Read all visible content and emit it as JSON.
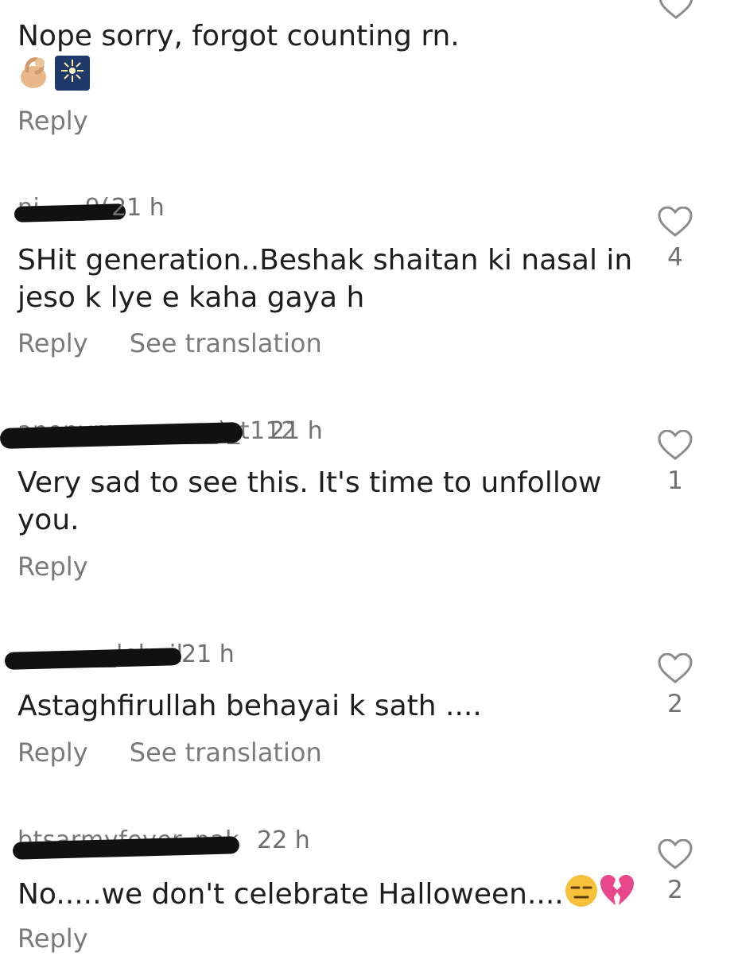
{
  "comments": [
    {
      "username": "",
      "time": "",
      "text": "Nope sorry, forgot counting rn.",
      "emojis": [
        "pinched-fingers-emoji",
        "fireworks-emoji"
      ],
      "reply_label": "Reply",
      "translation_label": "",
      "likes": ""
    },
    {
      "username": "ni__ _9(",
      "time": "21 h",
      "text": "SHit generation..Beshak shaitan ki nasal in jeso k lye e kaha gaya h",
      "reply_label": "Reply",
      "translation_label": "See translation",
      "likes": "4"
    },
    {
      "username": "anonymo_______)_t112",
      "time": "21 h",
      "text": "Very sad to see this. It's time to unfollow you.",
      "reply_label": "Reply",
      "translation_label": "",
      "likes": "1"
    },
    {
      "username": "________lehuil",
      "time": "21 h",
      "text": "Astaghfirullah behayai k sath ....",
      "reply_label": "Reply",
      "translation_label": "See translation",
      "likes": "2"
    },
    {
      "username": "btsarmyfever_pak",
      "time": "22 h",
      "text": "No.....we don't celebrate Halloween....",
      "emojis": [
        "expressionless-face-emoji",
        "broken-heart-emoji"
      ],
      "reply_label": "Reply",
      "translation_label": "",
      "likes": "2"
    }
  ],
  "colors": {
    "redaction": "#111111",
    "meta_text": "#6e6e6e",
    "body_text": "#1e1e1e"
  }
}
